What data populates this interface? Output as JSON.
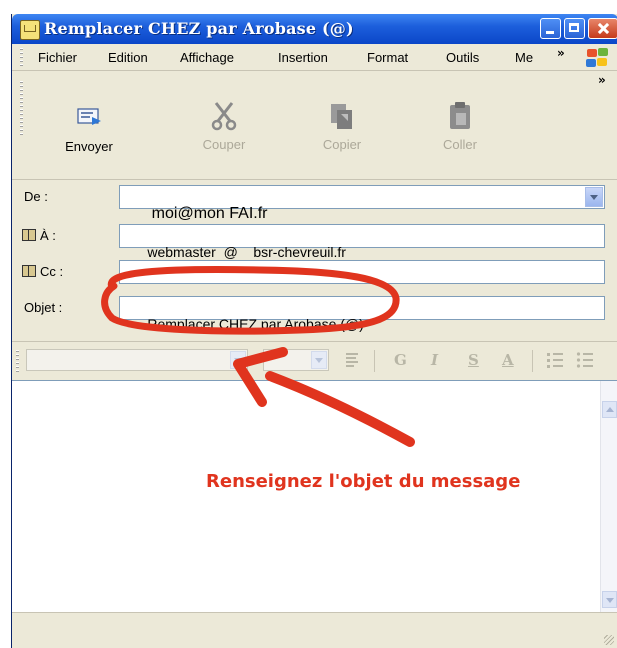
{
  "window": {
    "title": "Remplacer CHEZ par Arobase (@)"
  },
  "menu": {
    "items": [
      "Fichier",
      "Edition",
      "Affichage",
      "Insertion",
      "Format",
      "Outils",
      "Me"
    ],
    "overflow": "»",
    "toolbar_overflow": "»"
  },
  "toolbar": {
    "send": "Envoyer",
    "cut": "Couper",
    "copy": "Copier",
    "paste": "Coller"
  },
  "fields": {
    "from_label": "De :",
    "from_value": "moi@mon FAI.fr",
    "to_label": "À :",
    "to_value": "webmaster  @    bsr-chevreuil.fr",
    "cc_label": "Cc :",
    "cc_value": "",
    "subject_label": "Objet :",
    "subject_value": "Remplacer CHEZ par Arobase (@)"
  },
  "format_toolbar": {
    "bold": "G",
    "italic": "I",
    "underline": "S",
    "font_color": "A"
  },
  "annotation": {
    "text": "Renseignez l'objet du message",
    "color": "#e0341e"
  },
  "colors": {
    "titlebar": "#0a46c8",
    "chrome": "#ece9d8",
    "field_border": "#7f9db9"
  }
}
